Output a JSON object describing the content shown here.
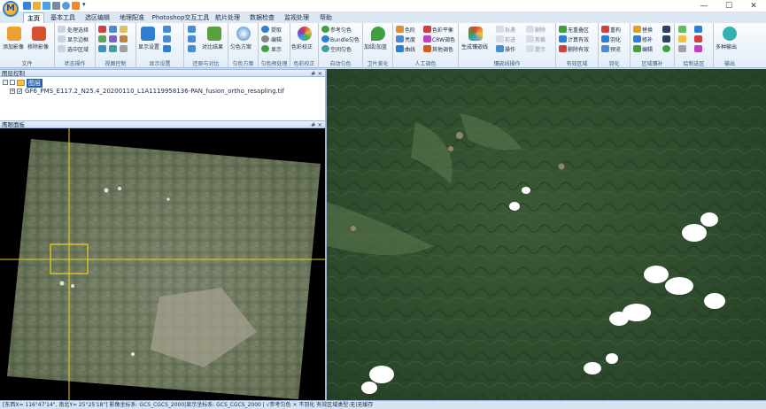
{
  "app": {
    "logo_letter": "M",
    "title_suffix": "▾",
    "window_controls": [
      "—",
      "☐",
      "✕"
    ]
  },
  "tabs": [
    "主页",
    "基本工具",
    "选区编辑",
    "地理配准",
    "Photoshop交互工具",
    "航片处理",
    "数据检查",
    "监视处理",
    "帮助"
  ],
  "ribbon": {
    "file": {
      "label": "文件",
      "add": "添加影像",
      "remove": "移除影像"
    },
    "state": {
      "label": "状态操作",
      "items": [
        "处理选择",
        "显示边框",
        "选中区域"
      ]
    },
    "view": {
      "label": "视图控制"
    },
    "display": {
      "label": "显示设置",
      "btn": "显示设置"
    },
    "restore": {
      "label": "还原与对比",
      "btn": "对比结果"
    },
    "dodge": {
      "label": "匀色方案",
      "btn": "匀色方案"
    },
    "preproc": {
      "label": "匀色预处理",
      "items": [
        "提取",
        "编辑",
        "显示"
      ]
    },
    "color": {
      "label": "色彩校正",
      "btn": "色彩校正"
    },
    "auto": {
      "label": "自动匀色",
      "items": [
        "参考匀色",
        "Bundle匀色",
        "空间匀色"
      ]
    },
    "sat": {
      "label": "卫片美化",
      "btn": "加绿/加蓝"
    },
    "manual": {
      "label": "人工调色",
      "items": [
        "色阶",
        "亮度",
        "曲线",
        "色彩平衡",
        "CRW调色",
        "其他调色"
      ]
    },
    "seam": {
      "label": "镶嵌线操作",
      "btn": "生成镶嵌线",
      "items": [
        "拆遇",
        "前进",
        "操作",
        "删除",
        "前后",
        "提示",
        "剪裁",
        "删除",
        "应用",
        "显示"
      ]
    },
    "valid": {
      "label": "有效区域",
      "items": [
        "无重叠区",
        "计算有效",
        "删除有效"
      ]
    },
    "feather": {
      "label": "羽化",
      "items": [
        "重构",
        "羽化",
        "预览"
      ]
    },
    "mosaic": {
      "label": "区域镶补",
      "items": [
        "替换",
        "修补",
        "编辑"
      ]
    },
    "draw": {
      "label": "绘制选区"
    },
    "output": {
      "label": "输出",
      "btn": "多种输出"
    }
  },
  "layer_panel": {
    "title": "图层控制",
    "pin": "# ×",
    "root": "图层",
    "file": "GF6_PMS_E117.2_N25.4_20200110_L1A1119958136-PAN_fusion_ortho_resapling.tif"
  },
  "overview_panel": {
    "title": "鹰眼面板",
    "pin": "# ×"
  },
  "status": "[东西X= 116°47'14\", 南北Y= 25°25'18\"] 影像坐标系: GCS_CGCS_2000|显示坐标系: GCS_CGCS_2000 | √参考匀色 × 不羽化 有效区域类型:无|无缓存",
  "colors": {
    "accent": "#2f7fd0",
    "ribbon": "#e3edf8",
    "crosshair": "#e6d020"
  }
}
